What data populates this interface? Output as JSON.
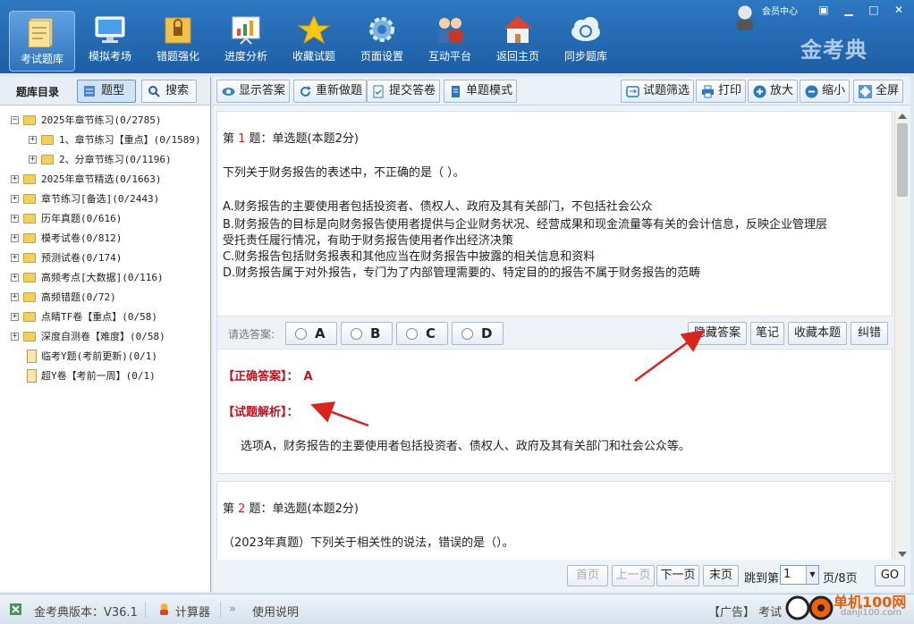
{
  "app": {
    "brand": "金考典",
    "member_center": "会员中心"
  },
  "toolbar": {
    "items": [
      {
        "label": "考试题库",
        "icon": "question-bank-icon",
        "active": true
      },
      {
        "label": "模拟考场",
        "icon": "monitor-icon"
      },
      {
        "label": "错题强化",
        "icon": "locked-folder-icon"
      },
      {
        "label": "进度分析",
        "icon": "chart-board-icon"
      },
      {
        "label": "收藏试题",
        "icon": "star-icon"
      },
      {
        "label": "页面设置",
        "icon": "gear-icon"
      },
      {
        "label": "互动平台",
        "icon": "users-icon"
      },
      {
        "label": "返回主页",
        "icon": "home-icon"
      },
      {
        "label": "同步题库",
        "icon": "cloud-sync-icon"
      }
    ]
  },
  "left": {
    "title": "题库目录",
    "tab_type": "题型",
    "tab_search": "搜索",
    "tree": [
      {
        "label": "2025年章节练习(0/2785)",
        "level": 0,
        "expanded": true,
        "type": "folder"
      },
      {
        "label": "1、章节练习【重点】(0/1589)",
        "level": 1,
        "type": "folder"
      },
      {
        "label": "2、分章节练习(0/1196)",
        "level": 1,
        "type": "folder"
      },
      {
        "label": "2025年章节精选(0/1663)",
        "level": 0,
        "type": "folder"
      },
      {
        "label": "章节练习[备选](0/2443)",
        "level": 0,
        "type": "folder"
      },
      {
        "label": "历年真题(0/616)",
        "level": 0,
        "type": "folder"
      },
      {
        "label": "模考试卷(0/812)",
        "level": 0,
        "type": "folder"
      },
      {
        "label": "预测试卷(0/174)",
        "level": 0,
        "type": "folder"
      },
      {
        "label": "高频考点[大数据](0/116)",
        "level": 0,
        "type": "folder"
      },
      {
        "label": "高频错题(0/72)",
        "level": 0,
        "type": "folder"
      },
      {
        "label": "点睛TF卷【重点】(0/58)",
        "level": 0,
        "type": "folder"
      },
      {
        "label": "深度自测卷【难度】(0/58)",
        "level": 0,
        "type": "folder"
      },
      {
        "label": "临考Y题(考前更新)(0/1)",
        "level": 0,
        "type": "locked"
      },
      {
        "label": "超Y卷【考前一周】(0/1)",
        "level": 0,
        "type": "locked"
      }
    ]
  },
  "right_toolbar": {
    "show_answer": "显示答案",
    "redo": "重新做题",
    "submit": "提交答卷",
    "single_mode": "单题模式",
    "filter": "试题筛选",
    "print": "打印",
    "zoom_in": "放大",
    "zoom_out": "缩小",
    "fullscreen": "全屏"
  },
  "q1": {
    "prefix": "第 ",
    "num": "1",
    "suffix": " 题：单选题(本题2分)",
    "stem": "下列关于财务报告的表述中，不正确的是（ ）。",
    "options": [
      "A.财务报告的主要使用者包括投资者、债权人、政府及其有关部门，不包括社会公众",
      "B.财务报告的目标是向财务报告使用者提供与企业财务状况、经营成果和现金流量等有关的会计信息，反映企业管理层",
      "受托责任履行情况，有助于财务报告使用者作出经济决策",
      "C.财务报告包括财务报表和其他应当在财务报告中披露的相关信息和资料",
      "D.财务报告属于对外报告，专门为了内部管理需要的、特定目的的报告不属于财务报告的范畴"
    ],
    "answer_prompt": "请选答案:",
    "choices": [
      "A",
      "B",
      "C",
      "D"
    ],
    "hide_answer": "隐藏答案",
    "notes": "笔记",
    "favorite": "收藏本题",
    "correct": "纠错",
    "correct_label": "【正确答案】：",
    "correct_value": "A",
    "analysis_label": "【试题解析】：",
    "analysis": "选项A，财务报告的主要使用者包括投资者、债权人、政府及其有关部门和社会公众等。"
  },
  "q2": {
    "prefix": "第 ",
    "num": "2",
    "suffix": " 题：单选题(本题2分)",
    "stem": "（2023年真题）下列关于相关性的说法，错误的是（）。"
  },
  "pager": {
    "first": "首页",
    "prev": "上一页",
    "next": "下一页",
    "last": "末页",
    "jump": "跳到第",
    "page": "1",
    "total": "页/8页",
    "go": "GO"
  },
  "status": {
    "version": "金考典版本：V36.1",
    "calculator": "计算器",
    "manual": "使用说明",
    "ad": "【广告】 考试",
    "watermark": "单机100网",
    "watermark_url": "danji100.com"
  }
}
